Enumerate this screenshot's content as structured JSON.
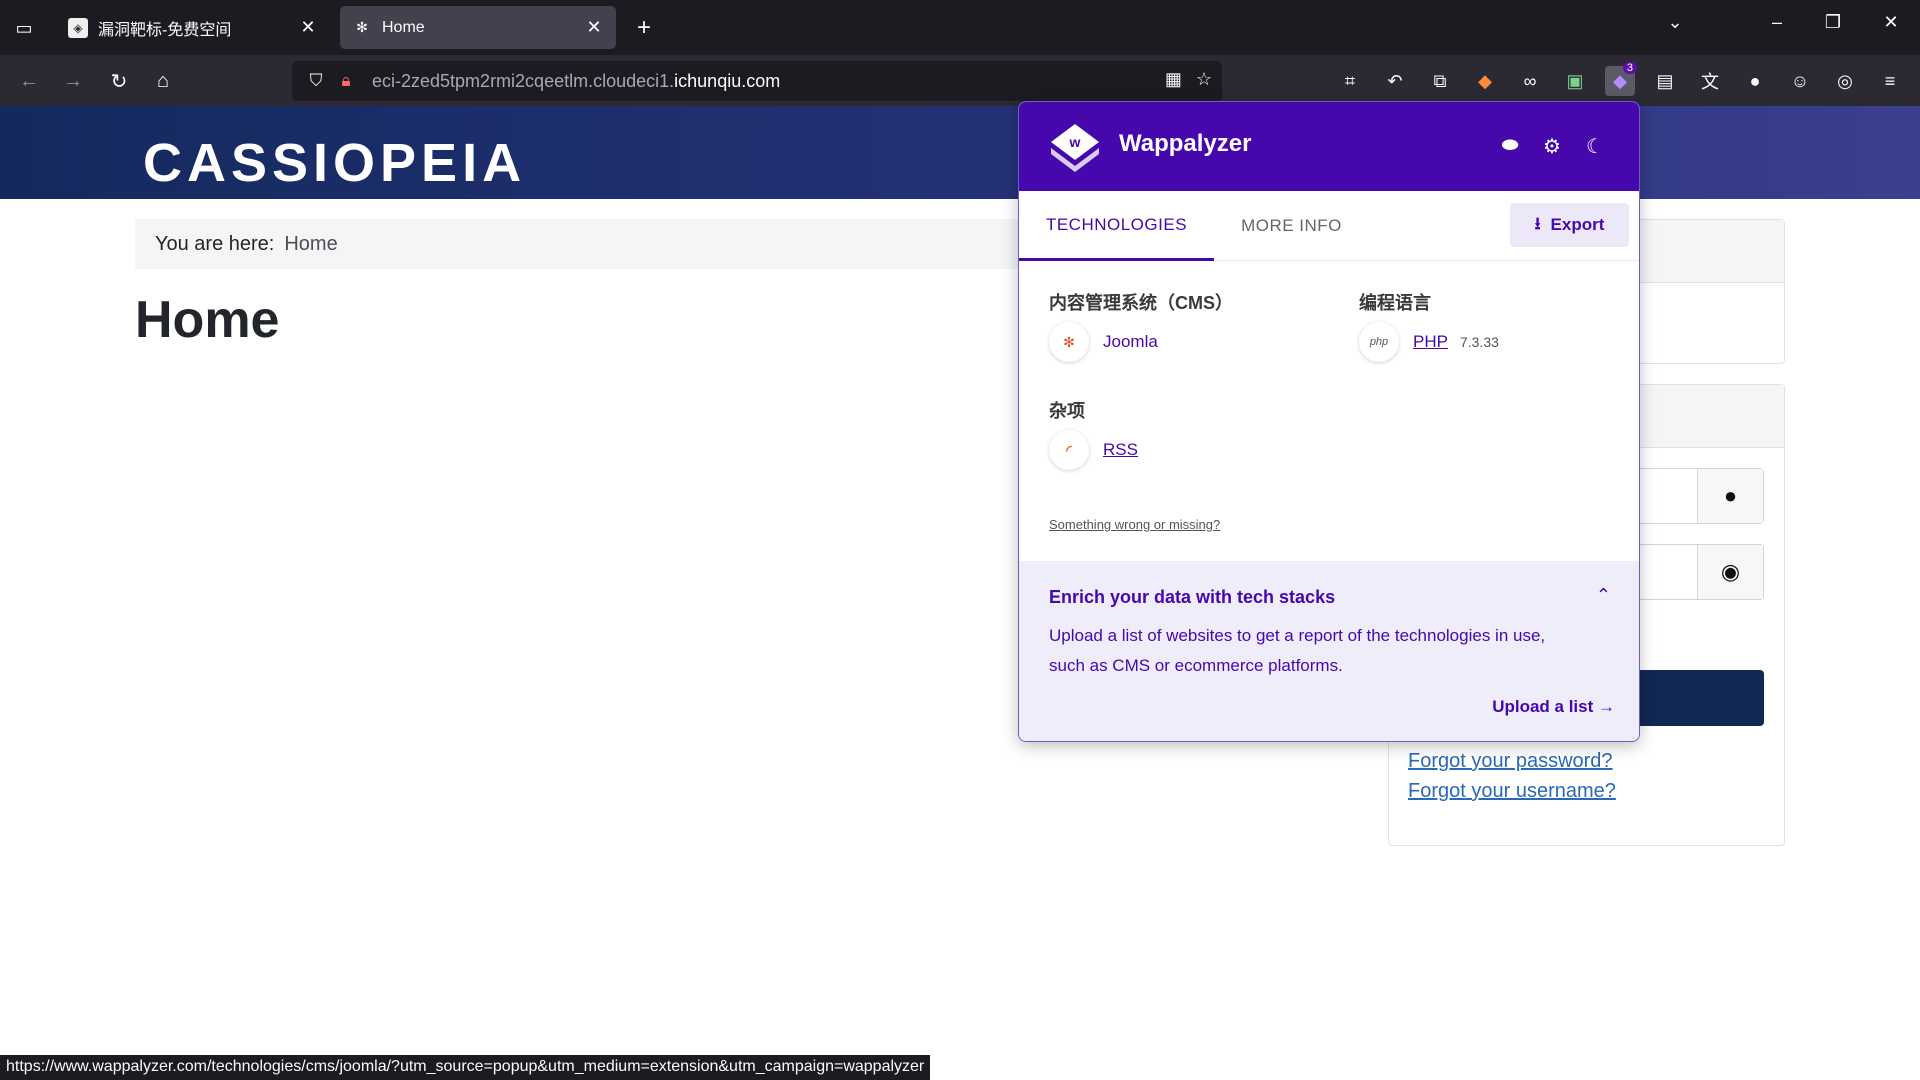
{
  "browser": {
    "tabs": [
      {
        "title": "漏洞靶标-免费空间",
        "active": false
      },
      {
        "title": "Home",
        "active": true
      }
    ],
    "url_prefix": "eci-2zed5tpm2rmi2cqeetlm.cloudeci1.",
    "url_domain": "ichunqiu.com",
    "ext_badge": "3"
  },
  "site": {
    "brand": "CASSIOPEIA",
    "breadcrumb_label": "You are here:",
    "breadcrumb_current": "Home",
    "page_title": "Home",
    "forgot_password": "Forgot your password?",
    "forgot_username": "Forgot your username?"
  },
  "wappalyzer": {
    "name": "Wappalyzer",
    "tab_technologies": "TECHNOLOGIES",
    "tab_more_info": "MORE INFO",
    "export_label": "Export",
    "categories": [
      {
        "name": "内容管理系统（CMS）",
        "tech": "Joomla",
        "version": ""
      },
      {
        "name": "编程语言",
        "tech": "PHP",
        "version": "7.3.33"
      },
      {
        "name": "杂项",
        "tech": "RSS",
        "version": ""
      }
    ],
    "feedback": "Something wrong or missing?",
    "enrich_title": "Enrich your data with tech stacks",
    "enrich_text": "Upload a list of websites to get a report of the technologies in use, such as CMS or ecommerce platforms.",
    "enrich_link": "Upload a list"
  },
  "status_url": "https://www.wappalyzer.com/technologies/cms/joomla/?utm_source=popup&utm_medium=extension&utm_campaign=wappalyzer",
  "colors": {
    "accent": "#4608ad",
    "header_bg": "#142a5e",
    "login_btn": "#112855"
  }
}
